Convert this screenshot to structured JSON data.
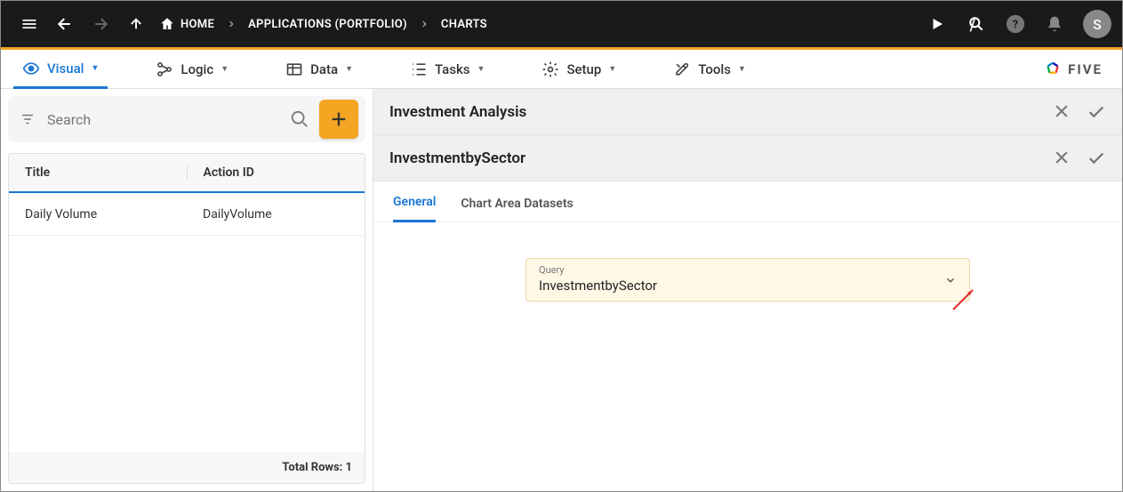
{
  "topbar": {
    "breadcrumbs": {
      "home": "HOME",
      "apps": "APPLICATIONS (PORTFOLIO)",
      "charts": "CHARTS"
    },
    "avatar_letter": "S"
  },
  "maintabs": {
    "visual": "Visual",
    "logic": "Logic",
    "data": "Data",
    "tasks": "Tasks",
    "setup": "Setup",
    "tools": "Tools"
  },
  "brand": "FIVE",
  "left": {
    "search_placeholder": "Search",
    "columns": {
      "title": "Title",
      "action": "Action ID"
    },
    "rows": [
      {
        "title": "Daily Volume",
        "action": "DailyVolume"
      }
    ],
    "footer": "Total Rows: 1"
  },
  "detail": {
    "header1": "Investment Analysis",
    "header2": "InvestmentbySector",
    "tabs": {
      "general": "General",
      "datasets": "Chart Area Datasets"
    },
    "query_label": "Query",
    "query_value": "InvestmentbySector"
  }
}
